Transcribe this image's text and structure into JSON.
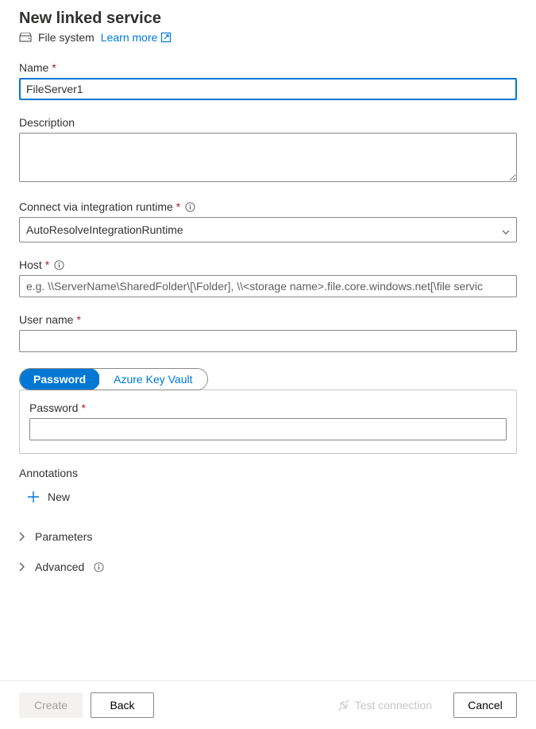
{
  "header": {
    "title": "New linked service",
    "service_type": "File system",
    "learn_more": "Learn more"
  },
  "fields": {
    "name": {
      "label": "Name",
      "value": "FileServer1",
      "required": true
    },
    "description": {
      "label": "Description",
      "value": "",
      "required": false
    },
    "runtime": {
      "label": "Connect via integration runtime",
      "required": true,
      "selected": "AutoResolveIntegrationRuntime"
    },
    "host": {
      "label": "Host",
      "required": true,
      "placeholder": "e.g. \\\\ServerName\\SharedFolder\\[\\Folder], \\\\<storage name>.file.core.windows.net[\\file servic",
      "value": ""
    },
    "username": {
      "label": "User name",
      "required": true,
      "value": ""
    }
  },
  "cred_tabs": {
    "password": "Password",
    "akv": "Azure Key Vault"
  },
  "password_box": {
    "label": "Password",
    "required": true,
    "value": ""
  },
  "annotations": {
    "heading": "Annotations",
    "new_label": "New"
  },
  "sections": {
    "parameters": "Parameters",
    "advanced": "Advanced"
  },
  "footer": {
    "create": "Create",
    "back": "Back",
    "test": "Test connection",
    "cancel": "Cancel"
  }
}
